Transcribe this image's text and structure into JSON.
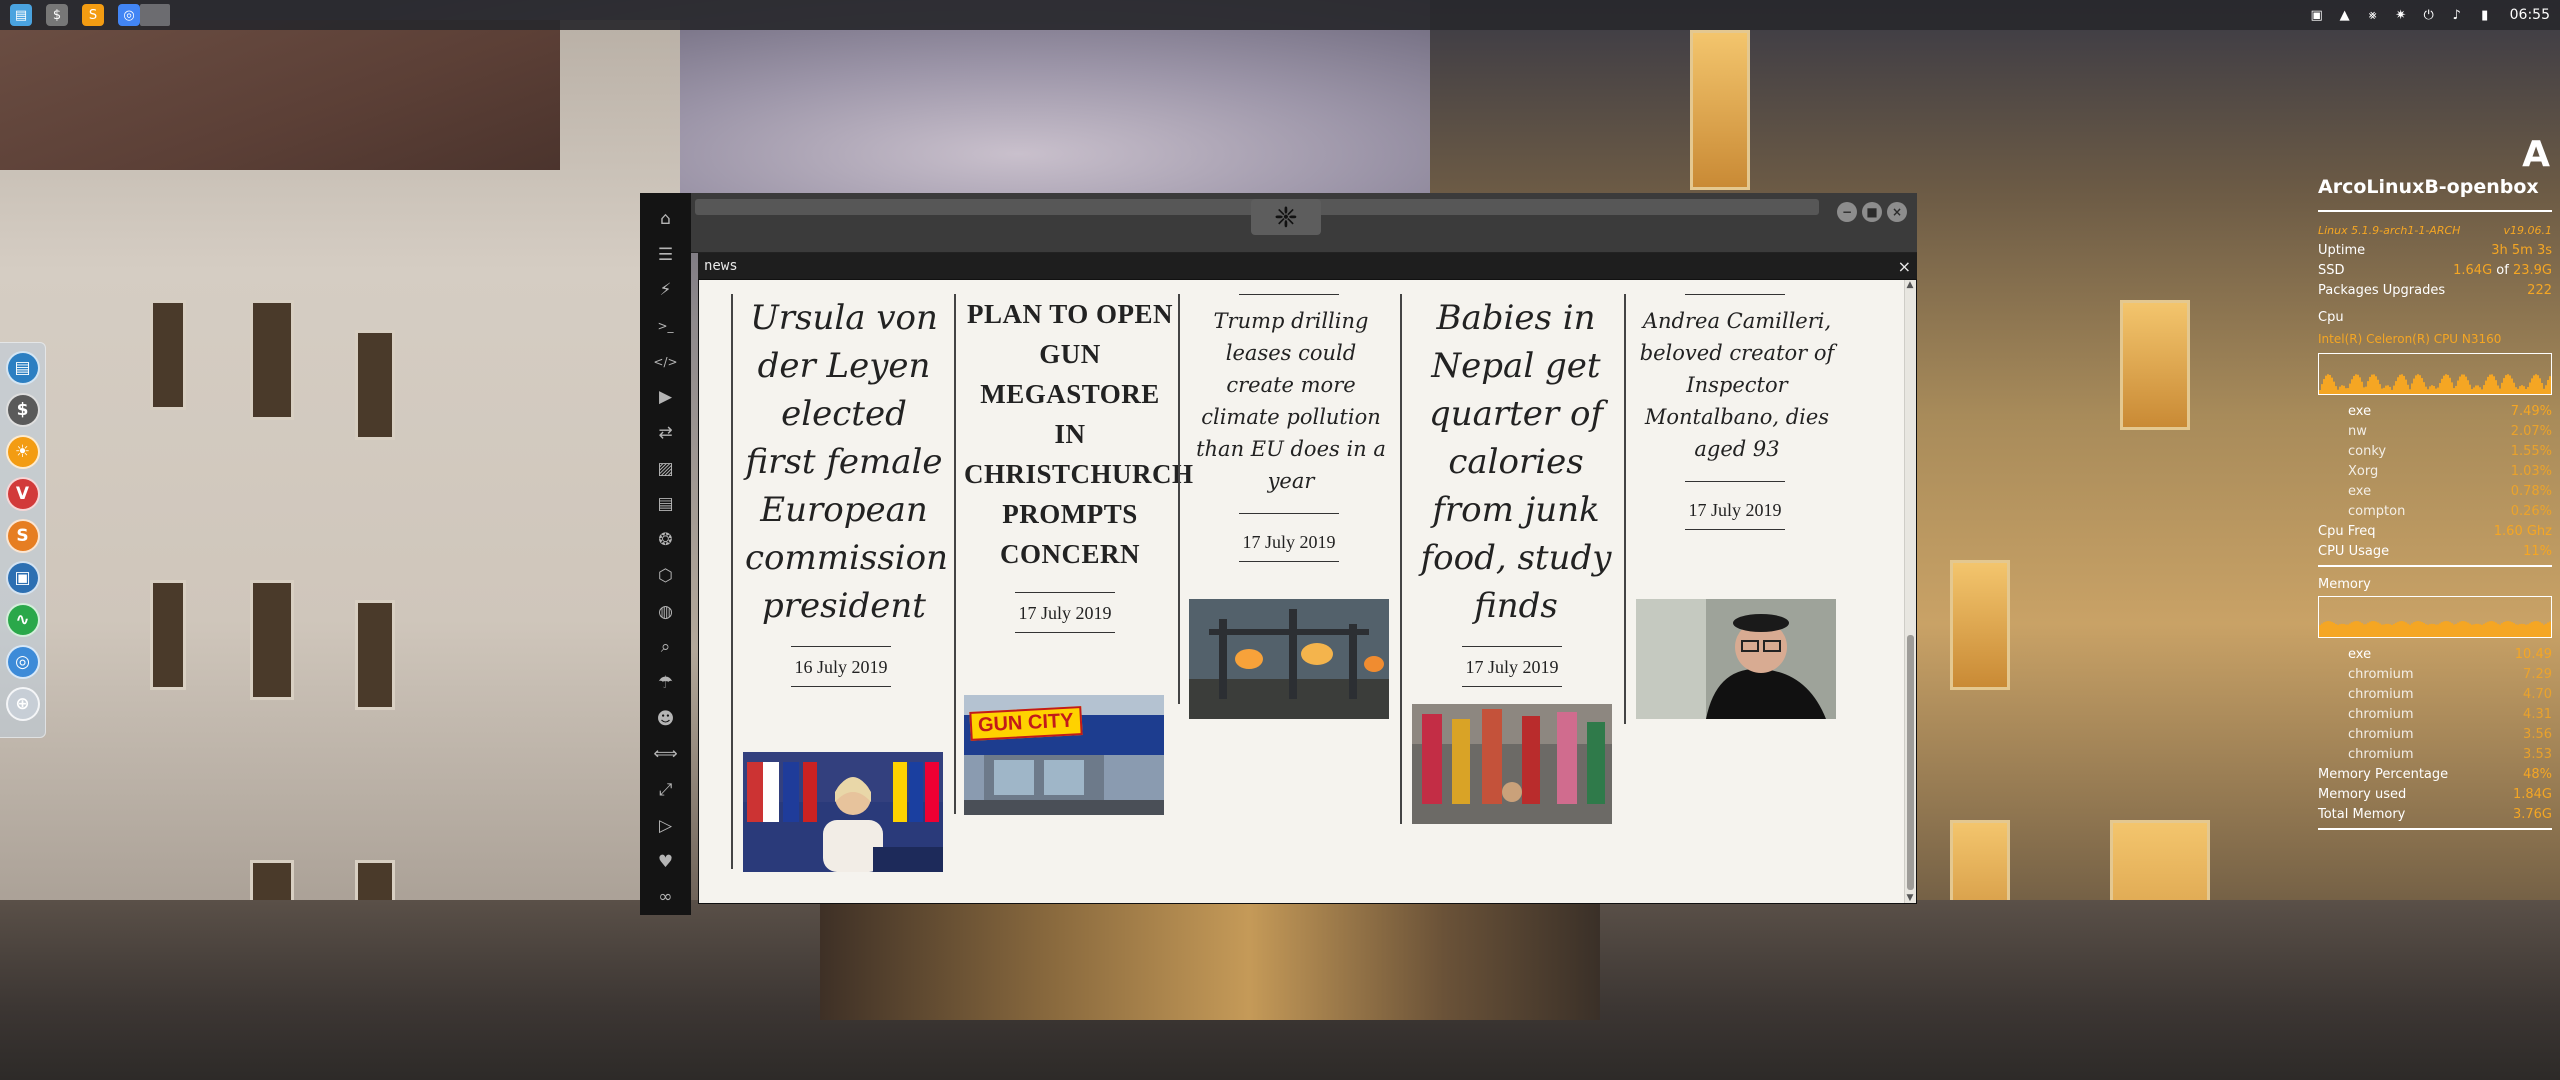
{
  "top_panel": {
    "launchers": [
      {
        "icon": "folder-icon",
        "glyph": "▤",
        "color": "#4aa3df"
      },
      {
        "icon": "dollar-terminal-icon",
        "glyph": "$",
        "color": "#777777"
      },
      {
        "icon": "sublime-text-icon",
        "glyph": "S",
        "color": "#f39c12"
      },
      {
        "icon": "chrome-icon",
        "glyph": "◎",
        "color": "#4285f4"
      }
    ],
    "tray": [
      {
        "icon": "network-icon",
        "glyph": "▣"
      },
      {
        "icon": "update-icon",
        "glyph": "▲"
      },
      {
        "icon": "bluetooth-icon",
        "glyph": "⨳"
      },
      {
        "icon": "alert-icon",
        "glyph": "✷"
      },
      {
        "icon": "power-icon",
        "glyph": "⏻"
      },
      {
        "icon": "volume-icon",
        "glyph": "♪"
      },
      {
        "icon": "battery-icon",
        "glyph": "▮"
      }
    ],
    "clock": "06:55"
  },
  "dock": [
    {
      "icon": "files-icon",
      "glyph": "▤",
      "color": "#2c7fc2"
    },
    {
      "icon": "dollar-icon",
      "glyph": "$",
      "color": "#5a5a5a"
    },
    {
      "icon": "sun-icon",
      "glyph": "☀",
      "color": "#f39c12"
    },
    {
      "icon": "vivaldi-icon",
      "glyph": "V",
      "color": "#d23a3a"
    },
    {
      "icon": "s-icon",
      "glyph": "S",
      "color": "#e67e22"
    },
    {
      "icon": "screenshot-icon",
      "glyph": "▣",
      "color": "#2c6fb2"
    },
    {
      "icon": "activity-icon",
      "glyph": "∿",
      "color": "#2aa84a"
    },
    {
      "icon": "chromium-icon",
      "glyph": "◎",
      "color": "#3d8bd8"
    },
    {
      "icon": "globe-icon",
      "glyph": "⊕",
      "color": "#c7ced6"
    }
  ],
  "app": {
    "sidebar_icons": [
      {
        "icon": "home-icon",
        "glyph": "⌂"
      },
      {
        "icon": "document-icon",
        "glyph": "☰"
      },
      {
        "icon": "lightning-icon",
        "glyph": "⚡"
      },
      {
        "icon": "terminal-icon",
        "glyph": ">_"
      },
      {
        "icon": "code-icon",
        "glyph": "</>"
      },
      {
        "icon": "play-icon",
        "glyph": "▶"
      },
      {
        "icon": "translate-icon",
        "glyph": "⇄"
      },
      {
        "icon": "image-icon",
        "glyph": "▨"
      },
      {
        "icon": "news-icon",
        "glyph": "▤"
      },
      {
        "icon": "aperture-icon",
        "glyph": "❂"
      },
      {
        "icon": "hexagon-icon",
        "glyph": "⬡"
      },
      {
        "icon": "globe-icon",
        "glyph": "◍"
      },
      {
        "icon": "search-icon",
        "glyph": "⌕"
      },
      {
        "icon": "umbrella-icon",
        "glyph": "☂"
      },
      {
        "icon": "contact-icon",
        "glyph": "☻"
      },
      {
        "icon": "arrows-icon",
        "glyph": "⟺"
      },
      {
        "icon": "expand-icon",
        "glyph": "⤢"
      },
      {
        "icon": "youtube-icon",
        "glyph": "▷"
      },
      {
        "icon": "heart-icon",
        "glyph": "♥"
      },
      {
        "icon": "infinity-icon",
        "glyph": "∞"
      }
    ],
    "titlebar_logo_glyph": "❈",
    "window_buttons": {
      "minimize": "−",
      "maximize": "■",
      "close": "×"
    },
    "tab_label": "news",
    "tab_close": "×",
    "articles": [
      {
        "title": "Ursula von der Leyen elected first female European commission president",
        "date": "16 July 2019",
        "style": "italic"
      },
      {
        "title": "PLAN TO OPEN GUN MEGASTORE IN CHRISTCHURCH PROMPTS CONCERN",
        "date": "17 July 2019",
        "style": "bold",
        "image_text": "GUN CITY"
      },
      {
        "title": "Trump drilling leases could create more climate pollution than EU does in a year",
        "date": "17 July 2019",
        "style": "italic"
      },
      {
        "title": "Babies in Nepal get quarter of calories from junk food, study finds",
        "date": "17 July 2019",
        "style": "italic"
      },
      {
        "title": "Andrea Camilleri, beloved creator of Inspector Montalbano, dies aged 93",
        "date": "17 July 2019",
        "style": "italic"
      }
    ]
  },
  "conky": {
    "hostname": "ArcoLinuxB-openbox",
    "logo_glyph": "A",
    "kernel": "Linux 5.1.9-arch1-1-ARCH",
    "version": "v19.06.1",
    "uptime_label": "Uptime",
    "uptime": "3h 5m 3s",
    "ssd_label": "SSD",
    "ssd_used": "1.64G",
    "ssd_of": "of",
    "ssd_total": "23.9G",
    "packages_label": "Packages Upgrades",
    "packages": "222",
    "cpu_label": "Cpu",
    "cpu_model": "Intel(R) Celeron(R) CPU N3160",
    "cpu_procs": [
      {
        "name": "exe",
        "value": "7.49%"
      },
      {
        "name": "nw",
        "value": "2.07%"
      },
      {
        "name": "conky",
        "value": "1.55%"
      },
      {
        "name": "Xorg",
        "value": "1.03%"
      },
      {
        "name": "exe",
        "value": "0.78%"
      },
      {
        "name": "compton",
        "value": "0.26%"
      }
    ],
    "cpu_freq_label": "Cpu Freq",
    "cpu_freq": "1.60 Ghz",
    "cpu_usage_label": "CPU Usage",
    "cpu_usage": "11%",
    "memory_label": "Memory",
    "mem_procs": [
      {
        "name": "exe",
        "value": "10.49"
      },
      {
        "name": "chromium",
        "value": "7.29"
      },
      {
        "name": "chromium",
        "value": "4.70"
      },
      {
        "name": "chromium",
        "value": "4.31"
      },
      {
        "name": "chromium",
        "value": "3.56"
      },
      {
        "name": "chromium",
        "value": "3.53"
      }
    ],
    "mem_pct_label": "Memory Percentage",
    "mem_pct": "48%",
    "mem_used_label": "Memory used",
    "mem_used": "1.84G",
    "mem_total_label": "Total Memory",
    "mem_total": "3.76G",
    "accent": "#f5a623"
  }
}
